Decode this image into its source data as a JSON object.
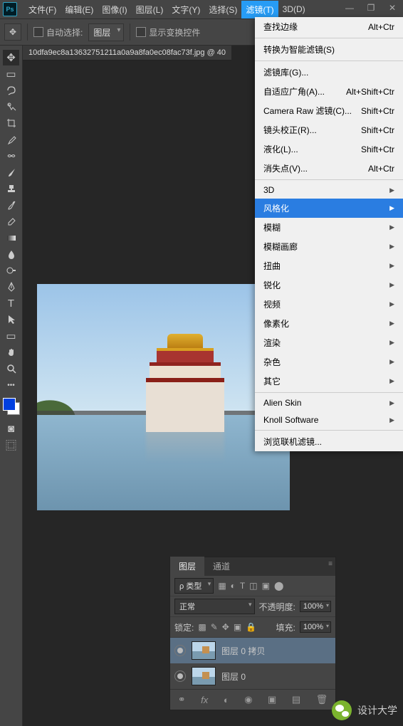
{
  "app": {
    "logo": "Ps"
  },
  "menu": {
    "file": "文件(F)",
    "edit": "编辑(E)",
    "image": "图像(I)",
    "layer": "图层(L)",
    "type": "文字(Y)",
    "select": "选择(S)",
    "filter": "滤镜(T)",
    "threeD": "3D(D)"
  },
  "options": {
    "autoSelect": "自动选择:",
    "autoSelectTarget": "图层",
    "showTransform": "显示变换控件"
  },
  "docTab": "10dfa9ec8a13632751211a0a9a8fa0ec08fac73f.jpg @ 40",
  "filterMenu": {
    "findEdges": {
      "label": "查找边缘",
      "shortcut": "Alt+Ctr"
    },
    "smart": {
      "label": "转换为智能滤镜(S)"
    },
    "gallery": {
      "label": "滤镜库(G)..."
    },
    "adaptive": {
      "label": "自适应广角(A)...",
      "shortcut": "Alt+Shift+Ctr"
    },
    "cameraRaw": {
      "label": "Camera Raw 滤镜(C)...",
      "shortcut": "Shift+Ctr"
    },
    "lens": {
      "label": "镜头校正(R)...",
      "shortcut": "Shift+Ctr"
    },
    "liquify": {
      "label": "液化(L)...",
      "shortcut": "Shift+Ctr"
    },
    "vanish": {
      "label": "消失点(V)...",
      "shortcut": "Alt+Ctr"
    },
    "threeD": {
      "label": "3D"
    },
    "stylize": {
      "label": "风格化"
    },
    "blur": {
      "label": "模糊"
    },
    "blurGallery": {
      "label": "模糊画廊"
    },
    "distort": {
      "label": "扭曲"
    },
    "sharpen": {
      "label": "锐化"
    },
    "video": {
      "label": "视频"
    },
    "pixelate": {
      "label": "像素化"
    },
    "render": {
      "label": "渲染"
    },
    "noise": {
      "label": "杂色"
    },
    "other": {
      "label": "其它"
    },
    "alien": {
      "label": "Alien Skin"
    },
    "knoll": {
      "label": "Knoll Software"
    },
    "browse": {
      "label": "浏览联机滤镜..."
    }
  },
  "layersPanel": {
    "tabLayers": "图层",
    "tabChannels": "通道",
    "kind": "类型",
    "blend": "正常",
    "opacityLabel": "不透明度:",
    "opacity": "100%",
    "lockLabel": "锁定:",
    "fillLabel": "填充:",
    "fill": "100%",
    "searchPrefix": "ρ",
    "layers": [
      {
        "name": "图层 0 拷贝"
      },
      {
        "name": "图层 0"
      }
    ]
  },
  "wechat": {
    "label": "设计大学"
  }
}
